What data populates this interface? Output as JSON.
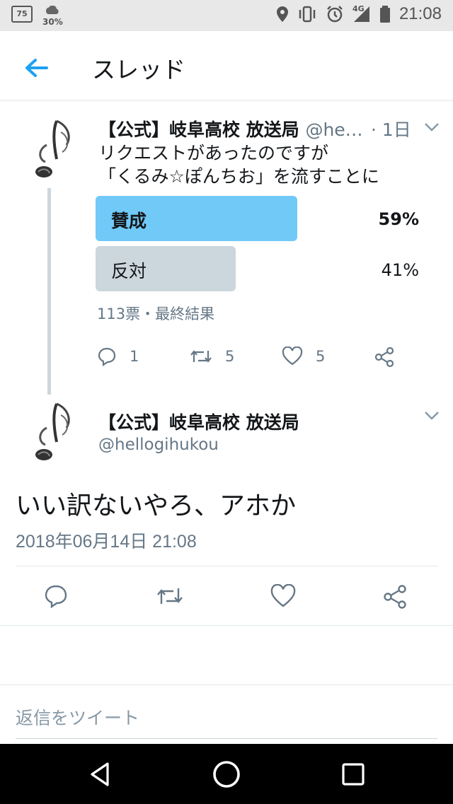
{
  "status_bar": {
    "app_badge": "75",
    "weather_percent": "30%",
    "network_type": "4G",
    "time": "21:08"
  },
  "header": {
    "title": "スレッド"
  },
  "tweet1": {
    "name": "【公式】岐阜高校 放送局",
    "handle": "@he…",
    "time": "· 1日",
    "text": "リクエストがあったのですが\n「くるみ☆ぽんちお」を流すことに",
    "poll": {
      "options": [
        {
          "label": "賛成",
          "percent": "59%",
          "value": 59
        },
        {
          "label": "反対",
          "percent": "41%",
          "value": 41
        }
      ],
      "summary": "113票・最終結果"
    },
    "counts": {
      "reply": "1",
      "retweet": "5",
      "like": "5"
    }
  },
  "tweet2": {
    "name": "【公式】岐阜高校 放送局",
    "handle": "@hellogihukou",
    "text": "いい訳ないやろ、アホか",
    "date": "2018年06月14日 21:08"
  },
  "compose": {
    "placeholder": "返信をツイート"
  },
  "colors": {
    "accent": "#1da1f2",
    "poll_winner": "#71c9f8",
    "poll_other": "#ccd6dd",
    "muted": "#657786"
  }
}
